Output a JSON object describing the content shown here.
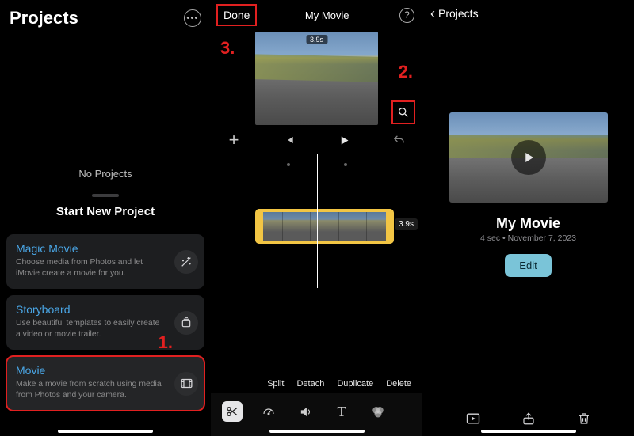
{
  "pane1": {
    "title": "Projects",
    "empty_label": "No Projects",
    "new_project_heading": "Start New Project",
    "options": [
      {
        "label": "Magic Movie",
        "desc": "Choose media from Photos and let iMovie create a movie for you.",
        "icon": "wand-icon"
      },
      {
        "label": "Storyboard",
        "desc": "Use beautiful templates to easily create a video or movie trailer.",
        "icon": "storyboard-icon"
      },
      {
        "label": "Movie",
        "desc": "Make a movie from scratch using media from Photos and your camera.",
        "icon": "film-icon"
      }
    ]
  },
  "pane2": {
    "done_label": "Done",
    "title": "My Movie",
    "clip_duration": "3.9s",
    "timeline_duration": "3.9s",
    "edit_ops": [
      "Split",
      "Detach",
      "Duplicate",
      "Delete"
    ]
  },
  "pane3": {
    "back_label": "Projects",
    "project_title": "My Movie",
    "meta": "4 sec • November 7, 2023",
    "edit_label": "Edit"
  },
  "annotations": {
    "a1": "1.",
    "a2": "2.",
    "a3": "3."
  },
  "colors": {
    "highlight_red": "#e12020",
    "link_blue": "#4aa7e7",
    "edit_btn": "#7ac4d8"
  }
}
